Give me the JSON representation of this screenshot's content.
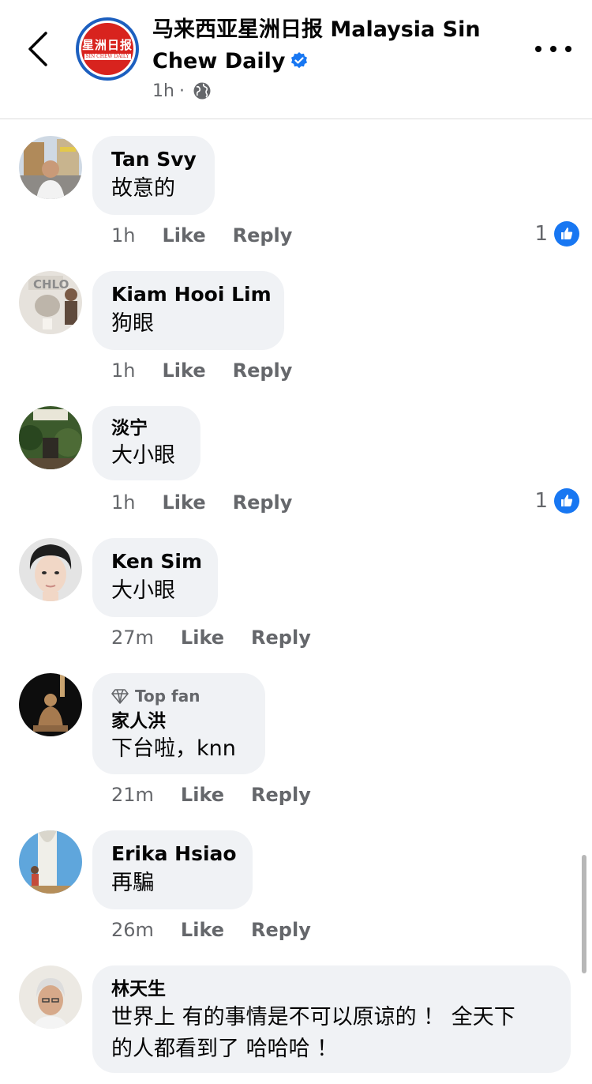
{
  "header": {
    "page_name": "马来西亚星洲日报 Malaysia Sin Chew Daily",
    "post_time": "1h",
    "separator": "·",
    "logo_text_cn": "星洲日报",
    "logo_text_en": "SIN CHEW DAILY",
    "verified_icon": "verified-check-icon",
    "audience_icon": "globe-icon"
  },
  "actions_labels": {
    "like": "Like",
    "reply": "Reply"
  },
  "colors": {
    "accent_blue": "#1877f2",
    "bubble_bg": "#f0f2f5",
    "secondary_text": "#65676b",
    "logo_red": "#d8231e"
  },
  "comments": [
    {
      "author": "Tan Svy",
      "text": "故意的",
      "time": "1h",
      "reactions": "1"
    },
    {
      "author": "Kiam Hooi Lim",
      "text": "狗眼",
      "time": "1h",
      "reactions": ""
    },
    {
      "author": "淡宁",
      "text": "大小眼",
      "time": "1h",
      "reactions": "1"
    },
    {
      "author": "Ken Sim",
      "text": "大小眼",
      "time": "27m",
      "reactions": ""
    },
    {
      "author": "家人洪",
      "badge": "Top fan",
      "text": "下台啦，knn",
      "time": "21m",
      "reactions": ""
    },
    {
      "author": "Erika Hsiao",
      "text": "再騙",
      "time": "26m",
      "reactions": ""
    },
    {
      "author": "林天生",
      "text_line1": "世界上 有的事情是不可以原谅的 ！ 全天下",
      "text_line2": "的人都看到了 哈哈哈 ！"
    }
  ]
}
